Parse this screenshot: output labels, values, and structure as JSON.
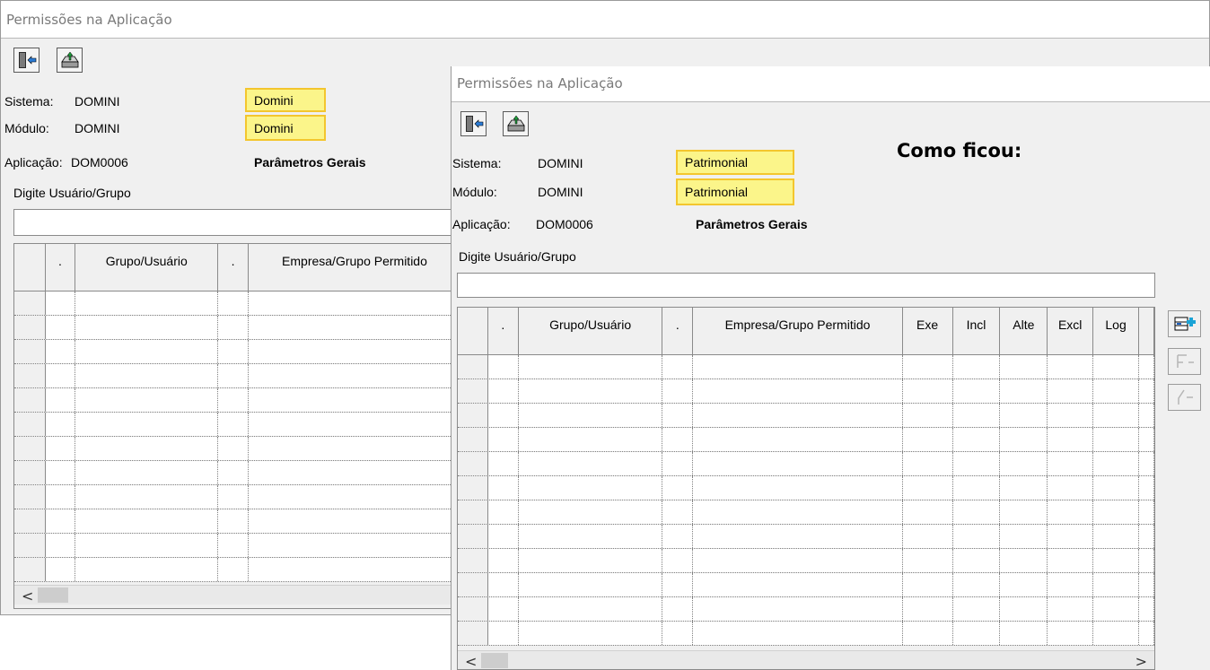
{
  "back_window": {
    "title": "Permissões na Aplicação",
    "toolbar": {
      "exit_icon": "exit-door-icon",
      "save_icon": "save-tray-icon"
    },
    "sistema_label": "Sistema:",
    "sistema_code": "DOMINI",
    "sistema_name": "Domini",
    "modulo_label": "Módulo:",
    "modulo_code": "DOMINI",
    "modulo_name": "Domini",
    "aplicacao_label": "Aplicação:",
    "aplicacao_code": "DOM0006",
    "aplicacao_name": "Parâmetros Gerais",
    "search_label": "Digite Usuário/Grupo",
    "search_value": "",
    "columns": [
      "",
      ".",
      "Grupo/Usuário",
      ".",
      "Empresa/Grupo Permitido"
    ],
    "row_count": 12,
    "scroll_left": "<"
  },
  "front_window": {
    "title": "Permissões na Aplicação",
    "toolbar": {
      "exit_icon": "exit-door-icon",
      "save_icon": "save-tray-icon"
    },
    "sistema_label": "Sistema:",
    "sistema_code": "DOMINI",
    "sistema_name": "Patrimonial",
    "modulo_label": "Módulo:",
    "modulo_code": "DOMINI",
    "modulo_name": "Patrimonial",
    "aplicacao_label": "Aplicação:",
    "aplicacao_code": "DOM0006",
    "aplicacao_name": "Parâmetros Gerais",
    "search_label": "Digite Usuário/Grupo",
    "search_value": "",
    "columns": [
      "",
      ".",
      "Grupo/Usuário",
      ".",
      "Empresa/Grupo Permitido",
      "Exe",
      "Incl",
      "Alte",
      "Excl",
      "Log",
      ""
    ],
    "row_count": 12,
    "scroll_left": "<",
    "scroll_right": ">",
    "side_buttons": [
      "add-row-icon",
      "insert-row-icon",
      "delete-row-icon"
    ]
  },
  "caption": "Como ficou:",
  "colors": {
    "highlight_fill": "#fbf58a",
    "highlight_border": "#f3c62e",
    "window_bg": "#f0f0f0"
  }
}
